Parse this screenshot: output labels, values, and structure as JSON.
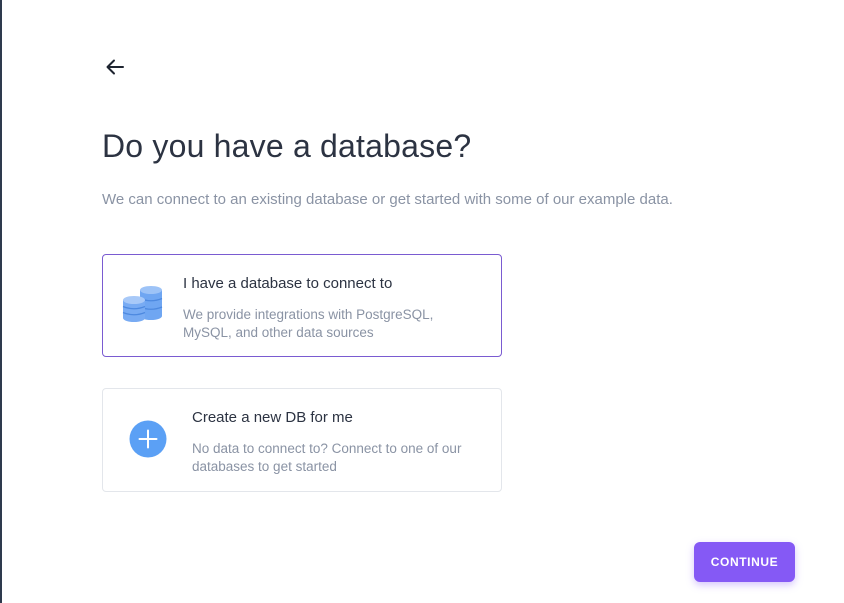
{
  "header": {
    "back_icon": "arrow-left-icon",
    "title": "Do you have a database?",
    "subtitle": "We can connect to an existing database or get started with some of our example data."
  },
  "options": [
    {
      "icon": "database-stack-icon",
      "title": "I have a database to connect to",
      "description": "We provide integrations with PostgreSQL, MySQL, and other data sources",
      "selected": true
    },
    {
      "icon": "plus-circle-icon",
      "title": "Create a new DB for me",
      "description": "No data to connect to? Connect to one of our databases to get started",
      "selected": false
    }
  ],
  "footer": {
    "continue_label": "CONTINUE"
  },
  "colors": {
    "accent": "#8559f5",
    "selected_border": "#7a5bd1",
    "icon_blue": "#5ba0f5",
    "title_text": "#2c3342",
    "muted_text": "#8a93a4"
  }
}
